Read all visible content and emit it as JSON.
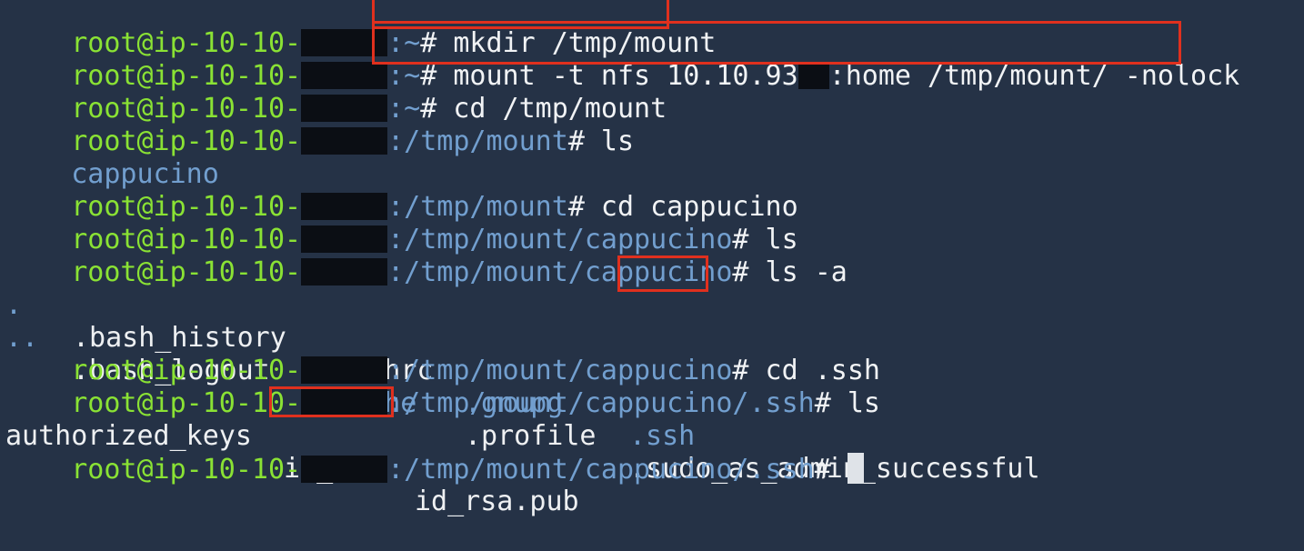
{
  "terminal": {
    "user": "root@ip-10-10-",
    "lines": [
      {
        "path": ":~",
        "cmd": " mkdir /tmp/mount"
      },
      {
        "path": ":~",
        "cmd": " mount -t nfs 10.10.93",
        "cmd_after_mask": ":home /tmp/mount/ -nolock"
      },
      {
        "path": ":~",
        "cmd": " cd /tmp/mount"
      },
      {
        "path": ":/tmp/mount",
        "cmd": " ls"
      },
      {
        "output": "cappucino"
      },
      {
        "path": ":/tmp/mount",
        "cmd": " cd cappucino"
      },
      {
        "path": ":/tmp/mount/cappucino",
        "cmd": " ls"
      },
      {
        "path": ":/tmp/mount/cappucino",
        "cmd": " ls -a"
      }
    ],
    "prompt_suffix": "#",
    "ls_a_row1": [
      ".",
      ".bash_history",
      ".bashrc",
      ".gnupg",
      ".ssh"
    ],
    "ls_a_row2": [
      "..",
      ".bash_logout",
      ".cache",
      ".profile",
      ".sudo_as_admin_successful"
    ],
    "after": [
      {
        "path": ":/tmp/mount/cappucino",
        "cmd": " cd .ssh"
      },
      {
        "path": ":/tmp/mount/cappucino/.ssh",
        "cmd": " ls"
      }
    ],
    "ssh_files": [
      "authorized_keys",
      "id_rsa",
      "id_rsa.pub"
    ],
    "final_path": ":/tmp/mount/cappucino/.ssh"
  },
  "colors": {
    "background": "#253246",
    "user": "#8ae234",
    "path": "#729fcf",
    "highlight": "#e0301e"
  }
}
